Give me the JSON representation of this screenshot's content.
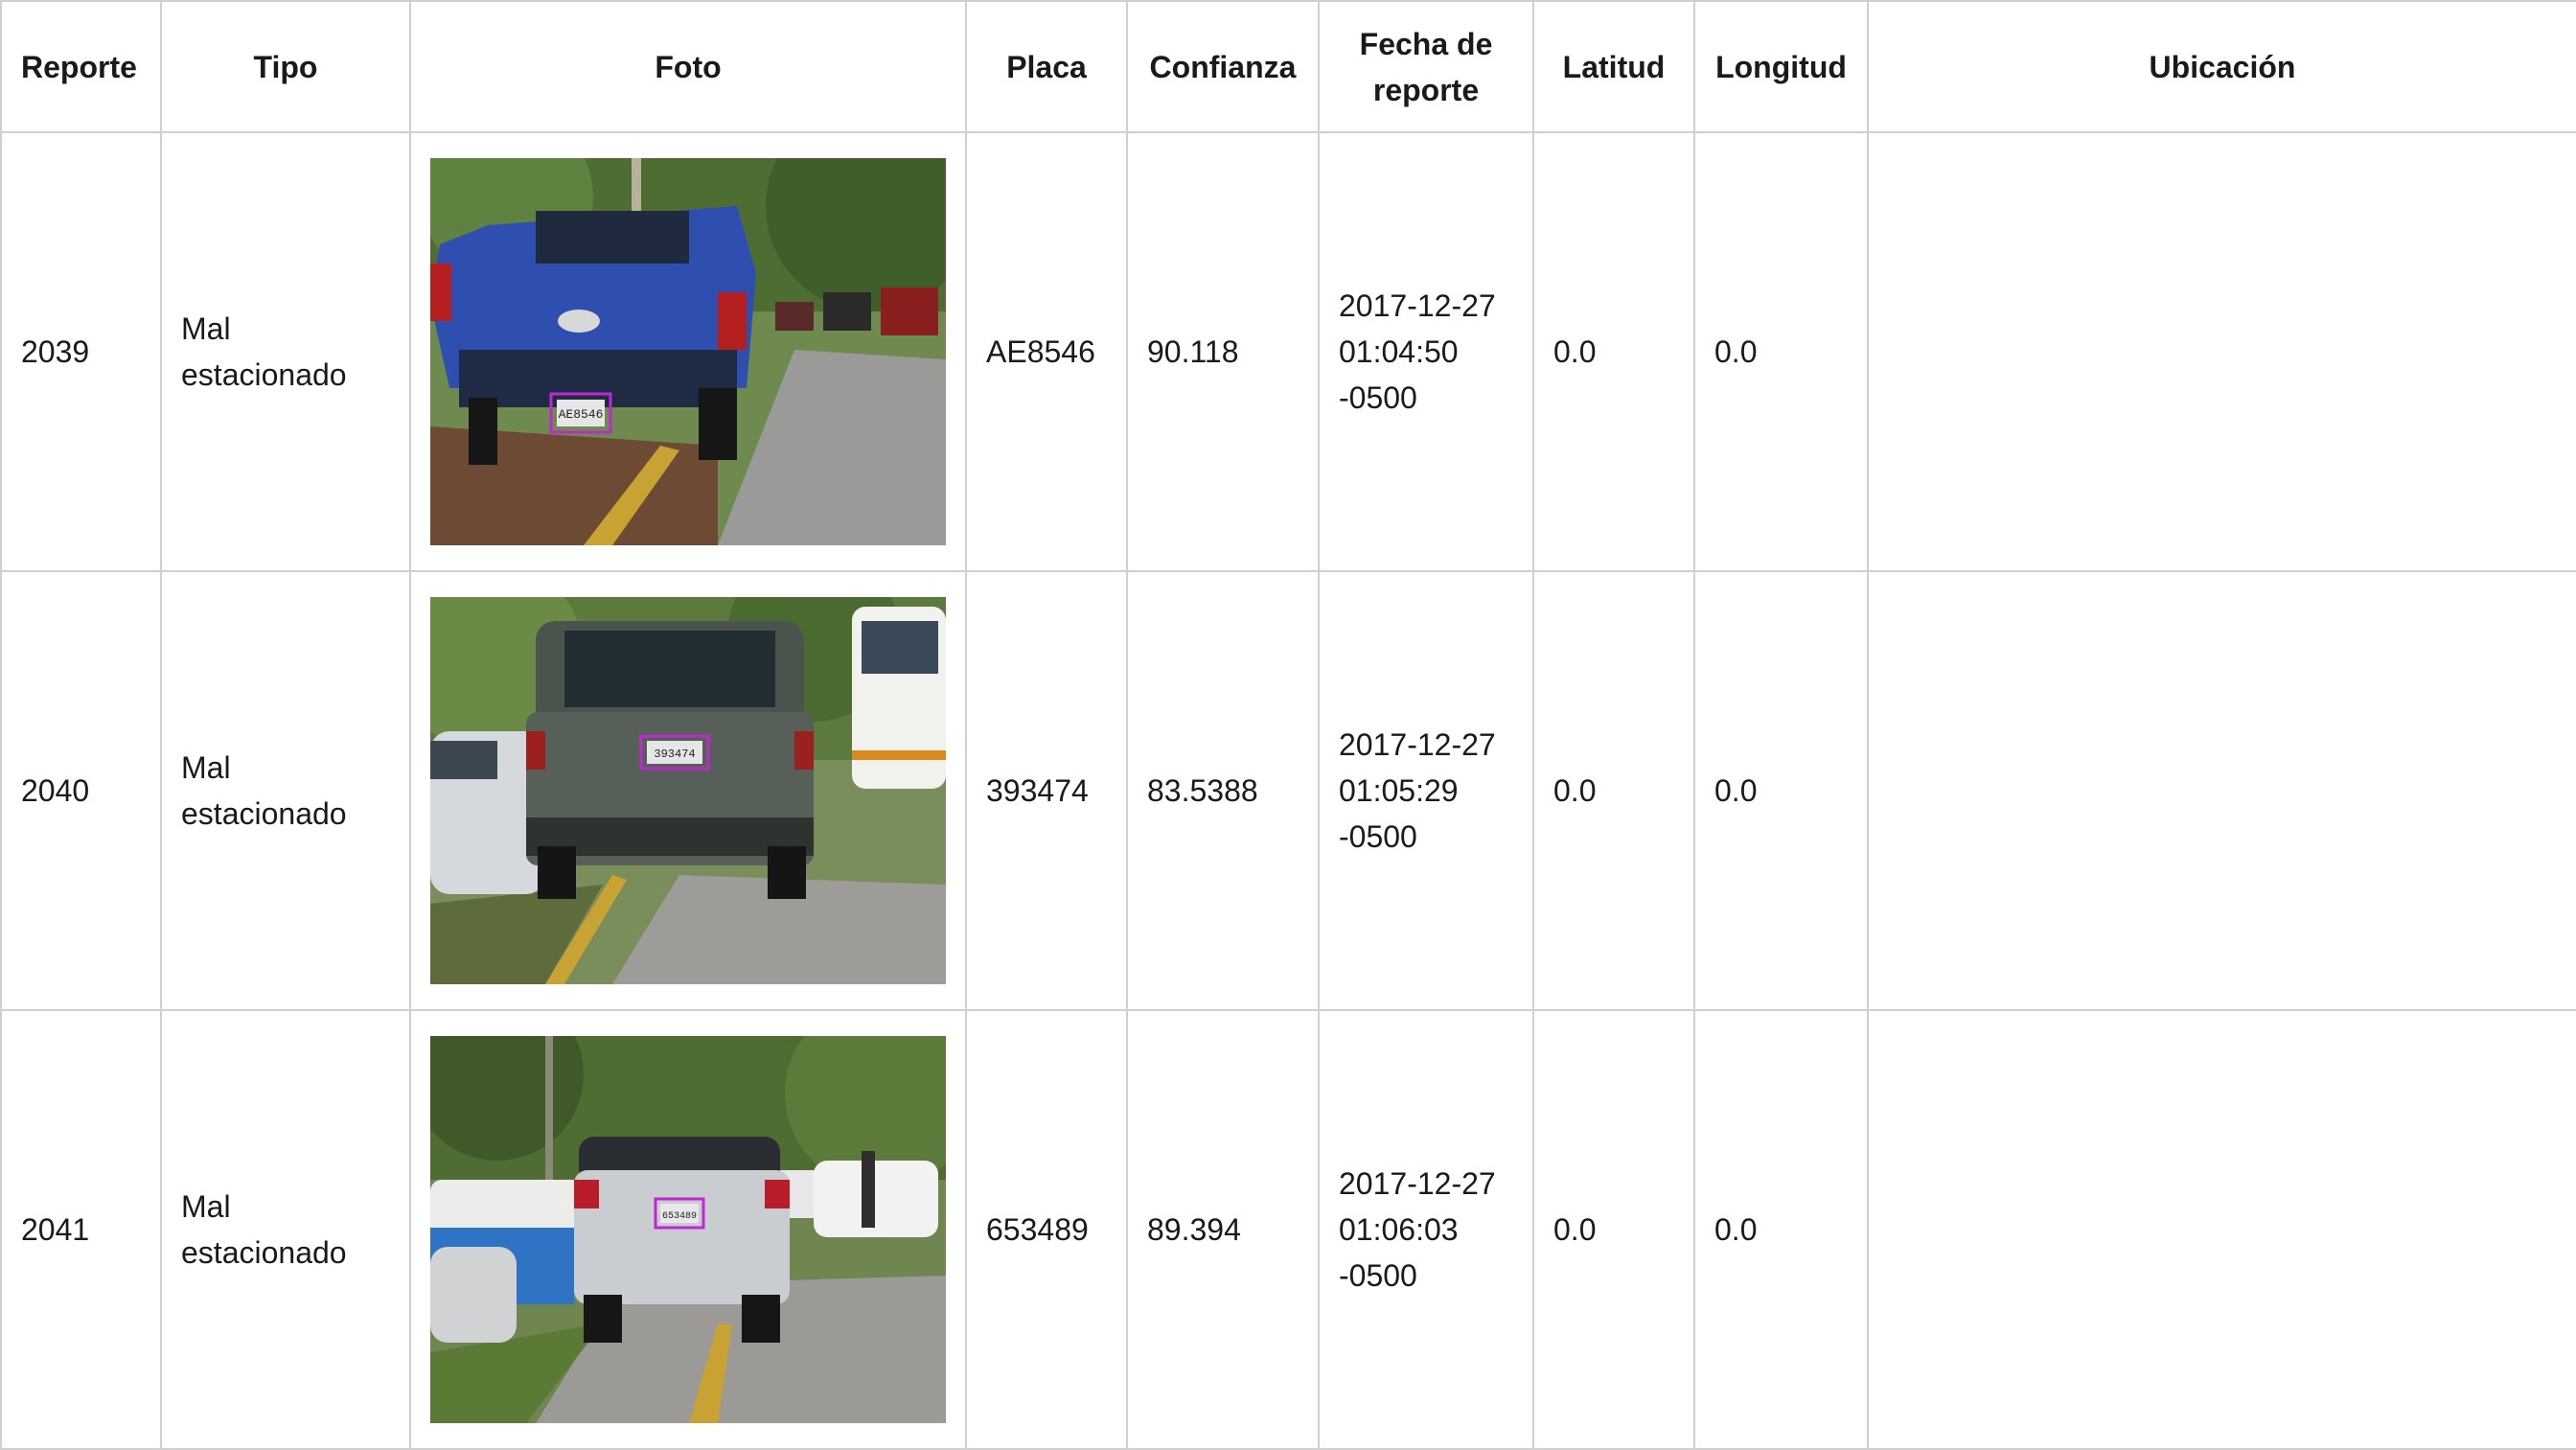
{
  "table": {
    "headers": {
      "reporte": "Reporte",
      "tipo": "Tipo",
      "foto": "Foto",
      "placa": "Placa",
      "confianza": "Confianza",
      "fecha": "Fecha de\nreporte",
      "latitud": "Latitud",
      "longitud": "Longitud",
      "ubicacion": "Ubicación"
    },
    "rows": [
      {
        "reporte": "2039",
        "tipo": "Mal\nestacionado",
        "placa": "AE8546",
        "confianza": "90.118",
        "fecha": "2017-12-27\n01:04:50\n-0500",
        "latitud": "0.0",
        "longitud": "0.0",
        "ubicacion": "",
        "photo": {
          "vehicle": "blue-pickup-truck",
          "plate_text": "AE8546",
          "body_color": "#2f4fb0"
        }
      },
      {
        "reporte": "2040",
        "tipo": "Mal\nestacionado",
        "placa": "393474",
        "confianza": "83.5388",
        "fecha": "2017-12-27\n01:05:29\n-0500",
        "latitud": "0.0",
        "longitud": "0.0",
        "ubicacion": "",
        "photo": {
          "vehicle": "gray-suv",
          "plate_text": "393474",
          "body_color": "#566058"
        }
      },
      {
        "reporte": "2041",
        "tipo": "Mal\nestacionado",
        "placa": "653489",
        "confianza": "89.394",
        "fecha": "2017-12-27\n01:06:03\n-0500",
        "latitud": "0.0",
        "longitud": "0.0",
        "ubicacion": "",
        "photo": {
          "vehicle": "silver-suv",
          "plate_text": "653489",
          "body_color": "#c9ccd0"
        }
      }
    ]
  },
  "colors": {
    "border": "#cfcfcf",
    "plate_box": "#c026d3"
  }
}
